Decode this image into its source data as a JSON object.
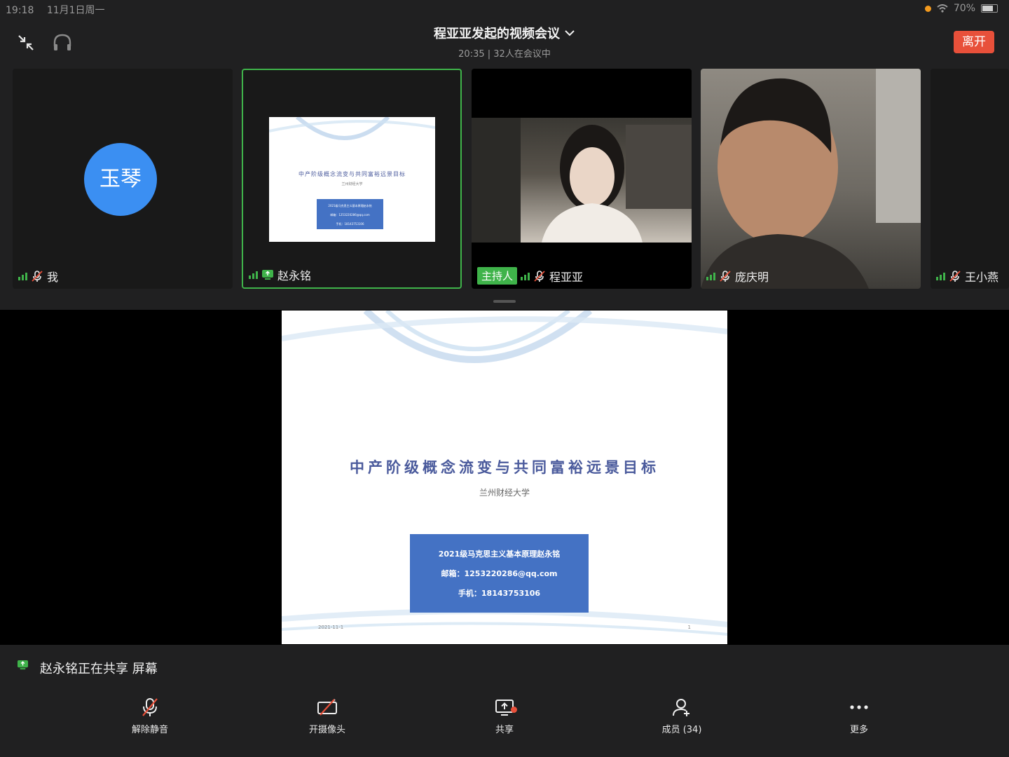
{
  "status_bar": {
    "time": "19:18",
    "date": "11月1日周一",
    "battery": "70%"
  },
  "header": {
    "title": "程亚亚发起的视频会议",
    "duration": "20:35",
    "participants_text": "32人在会议中",
    "leave_label": "离开"
  },
  "tiles": [
    {
      "name": "我",
      "avatar_text": "玉琴"
    },
    {
      "name": "赵永铭"
    },
    {
      "name": "程亚亚",
      "badge": "主持人"
    },
    {
      "name": "庞庆明"
    },
    {
      "name": "王小燕"
    }
  ],
  "slide": {
    "title": "中产阶级概念流变与共同富裕远景目标",
    "subtitle": "兰州财经大学",
    "box_line1": "2021级马克思主义基本原理赵永铭",
    "box_line2": "邮箱：1253220286@qq.com",
    "box_line3": "手机：18143753106",
    "date": "2021-11-1",
    "page": "1"
  },
  "notice": {
    "text": "赵永铭正在共享 屏幕"
  },
  "toolbar": {
    "unmute": "解除静音",
    "camera": "开摄像头",
    "share": "共享",
    "members": "成员 (34)",
    "more": "更多"
  },
  "colors": {
    "accent_green": "#3fb34a",
    "leave_red": "#e8503a",
    "avatar_blue": "#3b8ff2",
    "slide_blue": "#4472c4"
  }
}
